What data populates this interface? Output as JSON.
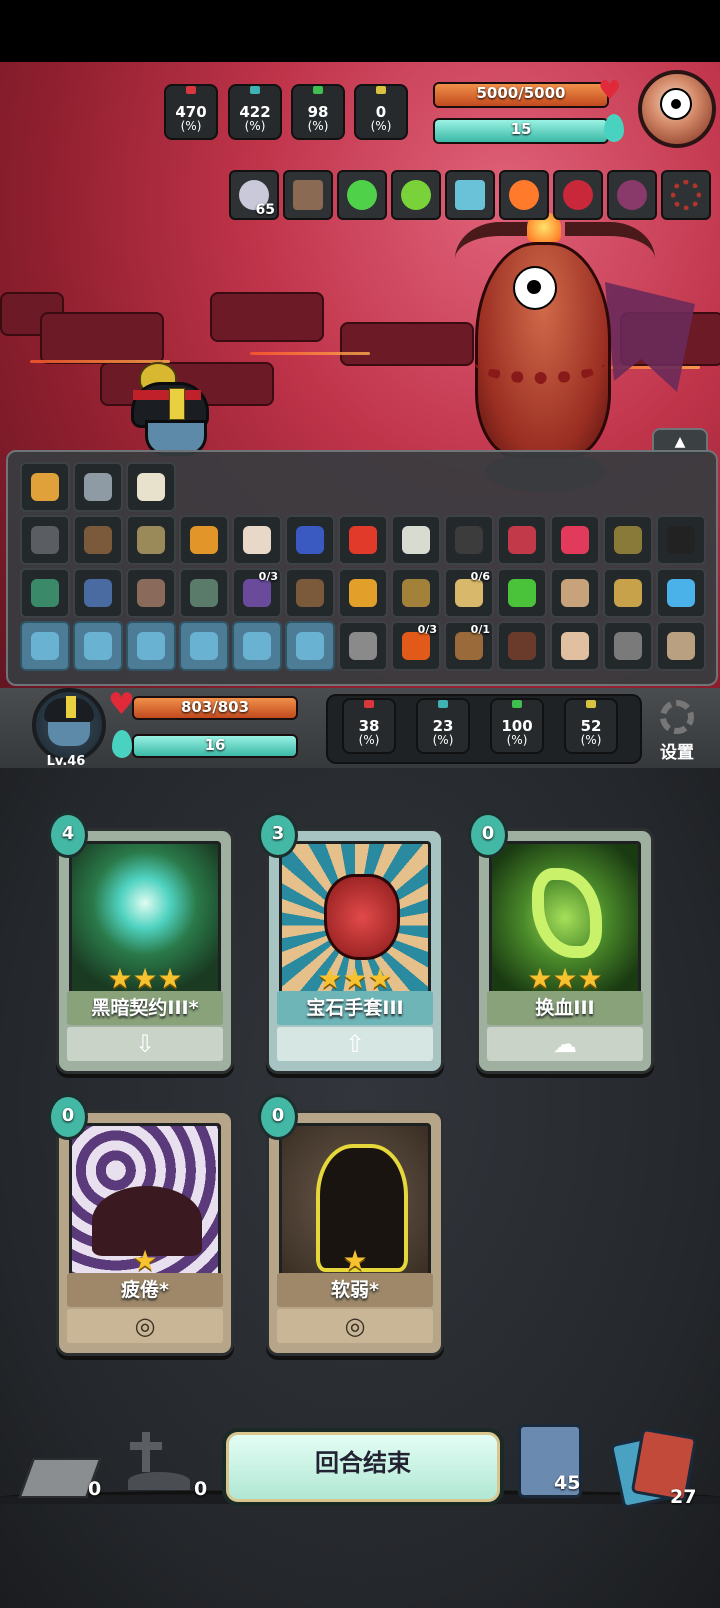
{
  "enemy": {
    "stats": [
      {
        "value": "470",
        "unit": "(%)",
        "color": "#d9363e",
        "icon": "sword-icon"
      },
      {
        "value": "422",
        "unit": "(%)",
        "color": "#3fb3b3",
        "icon": "question-shield-icon"
      },
      {
        "value": "98",
        "unit": "(%)",
        "color": "#3fbf4f",
        "icon": "castle-icon"
      },
      {
        "value": "0",
        "unit": "(%)",
        "color": "#d9c23f",
        "icon": "arrow-up-icon"
      }
    ],
    "hp": {
      "text": "5000/5000",
      "fraction": 1.0
    },
    "energy": {
      "text": "15",
      "fraction": 1.0
    },
    "relics": [
      {
        "icon": "spiral-eye-icon",
        "count": "65",
        "color": "#c9c9d9"
      },
      {
        "icon": "book-icon",
        "count": "",
        "color": "#8a6a52"
      },
      {
        "icon": "green-gem-icon",
        "count": "",
        "color": "#4fd24a"
      },
      {
        "icon": "green-leaf-icon",
        "count": "",
        "color": "#7ad23a"
      },
      {
        "icon": "lantern-icon",
        "count": "",
        "color": "#6ac2d9"
      },
      {
        "icon": "torch-icon",
        "count": "",
        "color": "#ff7a2a"
      },
      {
        "icon": "claw-icon",
        "count": "",
        "color": "#c8283a"
      },
      {
        "icon": "wing-icon",
        "count": "",
        "color": "#8a3a6a"
      },
      {
        "icon": "bead-ring-icon",
        "count": "",
        "color": "#b2352a"
      }
    ]
  },
  "inventory": {
    "toggle_icon": "▲",
    "rows": [
      [
        {
          "icon": "scroll-icon",
          "color": "#e0a13a",
          "count": ""
        },
        {
          "icon": "cube-icon",
          "color": "#8e9aa4",
          "count": ""
        },
        {
          "icon": "domino-icon",
          "color": "#e8e2cc",
          "count": ""
        }
      ],
      [
        {
          "icon": "helmet-icon",
          "color": "#5a5e62",
          "count": ""
        },
        {
          "icon": "glove-icon",
          "color": "#7a5a3a",
          "count": ""
        },
        {
          "icon": "turtle-icon",
          "color": "#9a8a5a",
          "count": ""
        },
        {
          "icon": "horn-icon",
          "color": "#e2962a",
          "count": ""
        },
        {
          "icon": "bone-icon",
          "color": "#e8d8c8",
          "count": ""
        },
        {
          "icon": "blade-icon",
          "color": "#3a5ac2",
          "count": ""
        },
        {
          "icon": "chili-icon",
          "color": "#e23a2a",
          "count": ""
        },
        {
          "icon": "ghost-icon",
          "color": "#d8dcd0",
          "count": ""
        },
        {
          "icon": "frame-icon",
          "color": "#3c3c3c",
          "count": ""
        },
        {
          "icon": "doll-icon",
          "color": "#c23a4a",
          "count": ""
        },
        {
          "icon": "red-mask-icon",
          "color": "#e23a5a",
          "count": ""
        },
        {
          "icon": "bag-icon",
          "color": "#8a7a3a",
          "count": ""
        },
        {
          "icon": "eye-mask-icon",
          "color": "#222222",
          "count": ""
        }
      ],
      [
        {
          "icon": "fish-icon",
          "color": "#3a8a6a",
          "count": ""
        },
        {
          "icon": "dagger-icon",
          "color": "#4a6aa2",
          "count": ""
        },
        {
          "icon": "claw-hand-icon",
          "color": "#8a6a5a",
          "count": ""
        },
        {
          "icon": "rope-icon",
          "color": "#5a7a6a",
          "count": ""
        },
        {
          "icon": "tome-icon",
          "color": "#6a4a9a",
          "count": "0/3"
        },
        {
          "icon": "sack-icon",
          "color": "#7a5a3a",
          "count": ""
        },
        {
          "icon": "horn-2-icon",
          "color": "#e2a02a",
          "count": ""
        },
        {
          "icon": "bell-icon",
          "color": "#a2823a",
          "count": ""
        },
        {
          "icon": "map-icon",
          "color": "#d8b86a",
          "count": "0/6"
        },
        {
          "icon": "slime-icon",
          "color": "#4ac23a",
          "count": ""
        },
        {
          "icon": "mummy-icon",
          "color": "#c8a27a",
          "count": ""
        },
        {
          "icon": "hourglass-icon",
          "color": "#c8a24a",
          "count": ""
        },
        {
          "icon": "water-icon",
          "color": "#4ab2e8",
          "count": ""
        }
      ],
      [
        {
          "icon": "rune-1-icon",
          "color": "#6ab2d2",
          "count": "",
          "blue": true
        },
        {
          "icon": "rune-2-icon",
          "color": "#6ab2d2",
          "count": "",
          "blue": true
        },
        {
          "icon": "rune-3-icon",
          "color": "#6ab2d2",
          "count": "",
          "blue": true
        },
        {
          "icon": "rune-4-icon",
          "color": "#6ab2d2",
          "count": "",
          "blue": true
        },
        {
          "icon": "rune-5-icon",
          "color": "#6ab2d2",
          "count": "",
          "blue": true
        },
        {
          "icon": "rune-6-icon",
          "color": "#6ab2d2",
          "count": "",
          "blue": true
        },
        {
          "icon": "gear-trinket-icon",
          "color": "#8a8a8a",
          "count": ""
        },
        {
          "icon": "fire-orb-icon",
          "color": "#e25a1a",
          "count": "0/3"
        },
        {
          "icon": "coin-bag-icon",
          "color": "#9a6a3a",
          "count": "0/1"
        },
        {
          "icon": "pot-icon",
          "color": "#6a3a2a",
          "count": ""
        },
        {
          "icon": "fist-icon",
          "color": "#e0c0a0",
          "count": ""
        },
        {
          "icon": "goggles-icon",
          "color": "#7a7a7a",
          "count": ""
        },
        {
          "icon": "shell-icon",
          "color": "#b8a080",
          "count": ""
        }
      ]
    ]
  },
  "player": {
    "level": "Lv.46",
    "hp": {
      "text": "803/803",
      "fraction": 1.0
    },
    "energy": {
      "text": "16",
      "fraction": 1.0
    },
    "stats": [
      {
        "value": "38",
        "unit": "(%)",
        "color": "#d9363e",
        "icon": "sword-icon"
      },
      {
        "value": "23",
        "unit": "(%)",
        "color": "#3fb3b3",
        "icon": "question-shield-icon"
      },
      {
        "value": "100",
        "unit": "(%)",
        "color": "#3fbf4f",
        "icon": "castle-icon"
      },
      {
        "value": "52",
        "unit": "(%)",
        "color": "#d9c23f",
        "icon": "arrow-up-icon"
      }
    ],
    "settings_label": "设置"
  },
  "hand": [
    {
      "cost": "4",
      "name": "黑暗契约III*",
      "stars": "★★★",
      "theme": "green",
      "type_icon": "⇩",
      "art": "dark-pact-art"
    },
    {
      "cost": "3",
      "name": "宝石手套III",
      "stars": "★★★",
      "theme": "teal",
      "type_icon": "⇧",
      "art": "gem-gauntlet-art"
    },
    {
      "cost": "0",
      "name": "换血III",
      "stars": "★★★",
      "theme": "green",
      "type_icon": "☁",
      "art": "blood-swap-art"
    },
    {
      "cost": "0",
      "name": "疲倦*",
      "stars": "★",
      "theme": "brown",
      "type_icon": "◎",
      "art": "fatigue-art"
    },
    {
      "cost": "0",
      "name": "软弱*",
      "stars": "★",
      "theme": "brown",
      "type_icon": "◎",
      "art": "weakness-art"
    }
  ],
  "bottom": {
    "exhaust_count": "0",
    "grave_count": "0",
    "end_turn_label": "回合结束",
    "draw_count": "45",
    "discard_count": "27"
  }
}
